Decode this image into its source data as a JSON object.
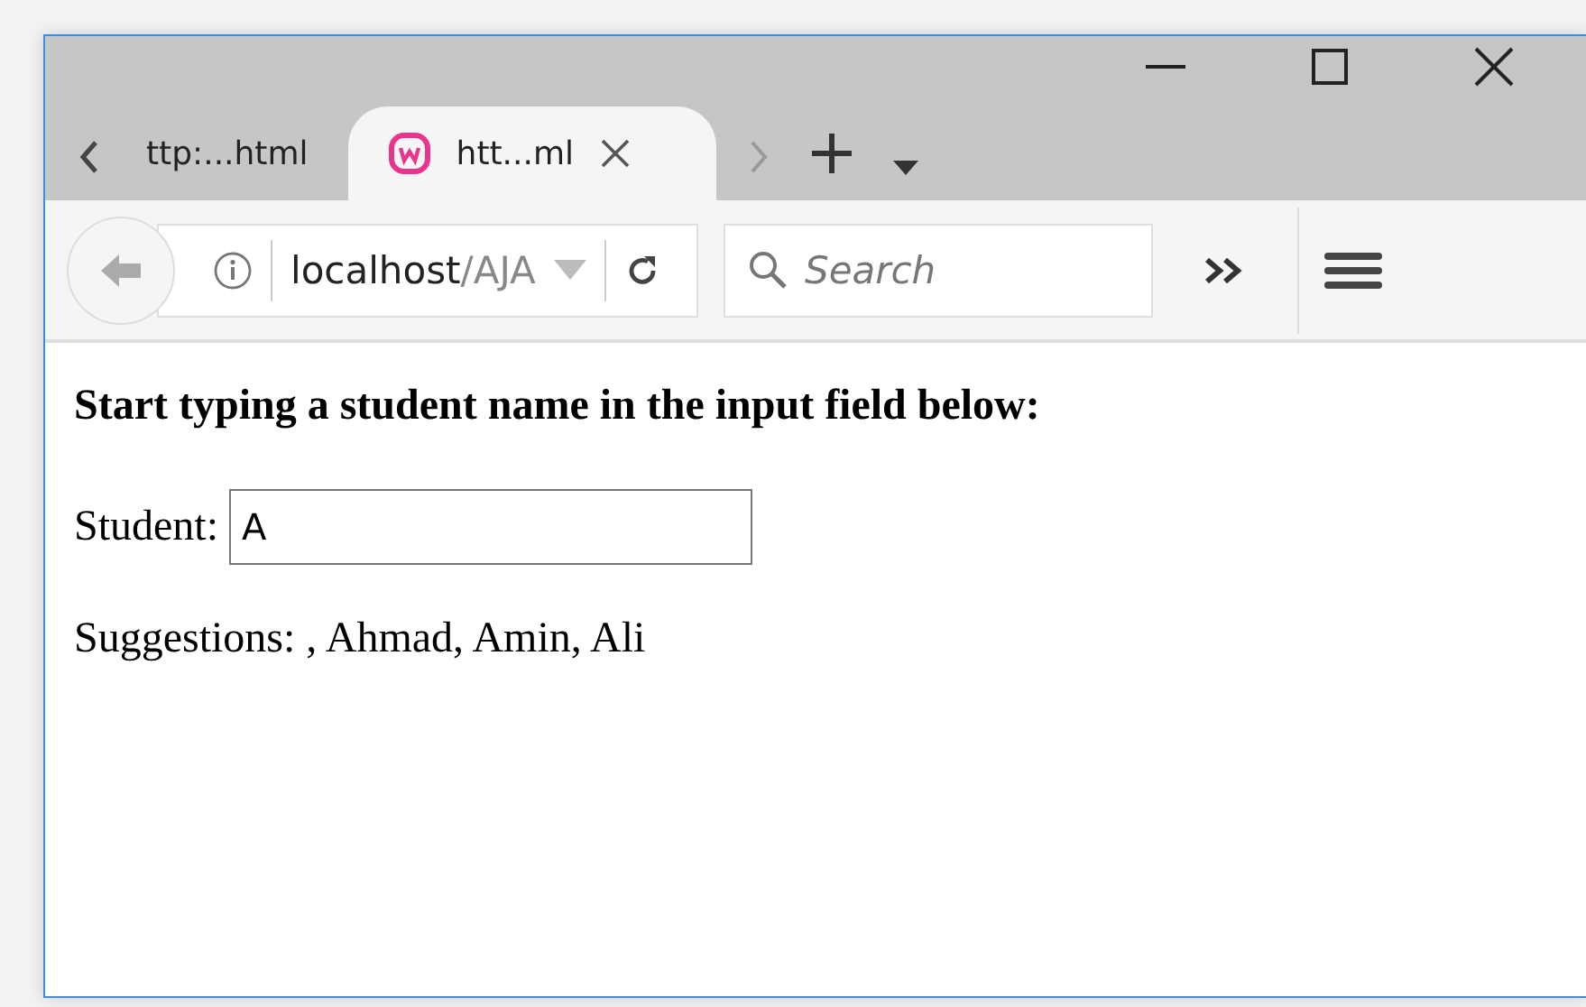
{
  "tabs": [
    {
      "label": "ttp:...html",
      "selected": false
    },
    {
      "label": "htt...ml",
      "selected": true
    }
  ],
  "address_bar": {
    "host": "localhost",
    "path": "/AJA"
  },
  "search": {
    "placeholder": "Search"
  },
  "page": {
    "heading": "Start typing a student name in the input field below:",
    "field_label": "Student:",
    "field_value": "A",
    "suggestions": "Suggestions: , Ahmad, Amin, Ali"
  }
}
